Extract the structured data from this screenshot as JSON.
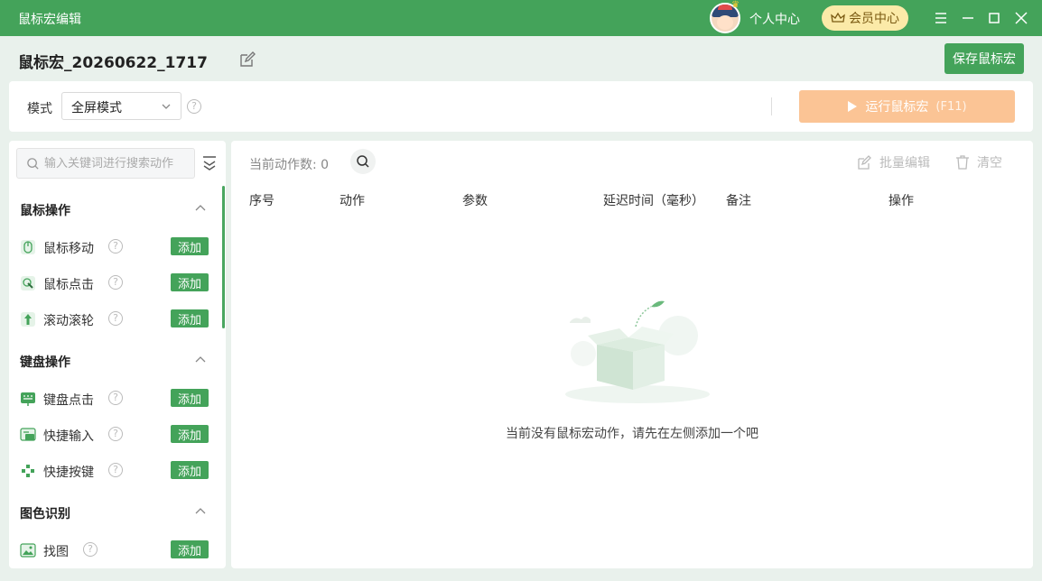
{
  "window": {
    "title": "鼠标宏编辑",
    "user_center": "个人中心",
    "vip_label": "会员中心"
  },
  "header": {
    "macro_name": "鼠标宏_20260622_1717",
    "save_label": "保存鼠标宏"
  },
  "mode": {
    "label": "模式",
    "selected": "全屏模式",
    "help": "?",
    "run_label": "运行鼠标宏",
    "run_shortcut": "(F11)"
  },
  "sidebar": {
    "search_placeholder": "输入关键词进行搜索动作",
    "add_label": "添加",
    "sections": [
      {
        "title": "鼠标操作",
        "items": [
          {
            "label": "鼠标移动"
          },
          {
            "label": "鼠标点击"
          },
          {
            "label": "滚动滚轮"
          }
        ]
      },
      {
        "title": "键盘操作",
        "items": [
          {
            "label": "键盘点击"
          },
          {
            "label": "快捷输入"
          },
          {
            "label": "快捷按键"
          }
        ]
      },
      {
        "title": "图色识别",
        "items": [
          {
            "label": "找图"
          }
        ]
      }
    ]
  },
  "main": {
    "count_label": "当前动作数:",
    "count_value": "0",
    "batch_edit_label": "批量编辑",
    "clear_label": "清空",
    "columns": [
      "序号",
      "动作",
      "参数",
      "延迟时间（毫秒）",
      "备注",
      "操作"
    ],
    "empty_text": "当前没有鼠标宏动作，请先在左侧添加一个吧"
  },
  "colors": {
    "brand_green": "#44a35a",
    "run_orange": "#fbc495",
    "vip_gold": "#fbeaa8"
  }
}
